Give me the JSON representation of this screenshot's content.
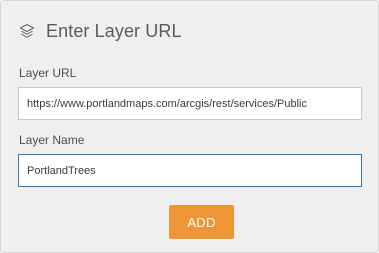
{
  "header": {
    "icon": "layers-icon",
    "title": "Enter Layer URL"
  },
  "layer_url": {
    "label": "Layer URL",
    "value": "https://www.portlandmaps.com/arcgis/rest/services/Public"
  },
  "layer_name": {
    "label": "Layer Name",
    "value": "PortlandTrees"
  },
  "actions": {
    "add_label": "ADD"
  },
  "colors": {
    "accent": "#ee9535",
    "focus_border": "#2f78b0",
    "panel_bg": "#efefef"
  }
}
